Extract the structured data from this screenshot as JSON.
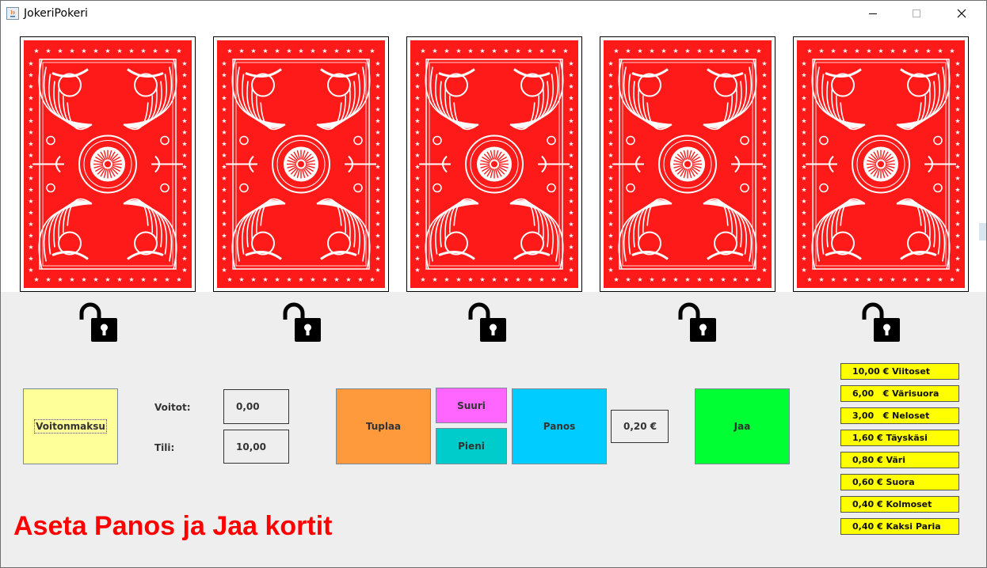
{
  "window": {
    "title": "JokeriPokeri",
    "controls": {
      "minimize": "minimize-icon",
      "maximize": "maximize-icon",
      "close": "close-icon"
    }
  },
  "cards": [
    {
      "face": "card-back",
      "lock": "unlocked"
    },
    {
      "face": "card-back",
      "lock": "unlocked"
    },
    {
      "face": "card-back",
      "lock": "unlocked"
    },
    {
      "face": "card-back",
      "lock": "unlocked"
    },
    {
      "face": "card-back",
      "lock": "unlocked"
    }
  ],
  "buttons": {
    "voitonmaksu": "Voitonmaksu",
    "tuplaa": "Tuplaa",
    "suuri": "Suuri",
    "pieni": "Pieni",
    "panos": "Panos",
    "jaa": "Jaa"
  },
  "labels": {
    "voitot": "Voitot:",
    "tili": "Tili:"
  },
  "fields": {
    "voitot": "0,00",
    "tili": "10,00",
    "panos": "0,20 €"
  },
  "paytable": [
    "10,00 € Viitoset",
    "6,00   € Värisuora",
    "3,00   € Neloset",
    "1,60 € Täyskäsi",
    "0,80 € Väri",
    "0,60 € Suora",
    "0,40 € Kolmoset",
    "0,40 € Kaksi Paria"
  ],
  "status": "Aseta Panos ja Jaa kortit",
  "colors": {
    "card_back": "#ff1a1a",
    "voitonmaksu": "#ffff99",
    "tuplaa": "#ff9a3c",
    "suuri": "#ff66ff",
    "pieni": "#00cccc",
    "panos": "#00ccff",
    "jaa": "#00ff33",
    "paytable": "#ffff00",
    "status": "#ff0000"
  }
}
